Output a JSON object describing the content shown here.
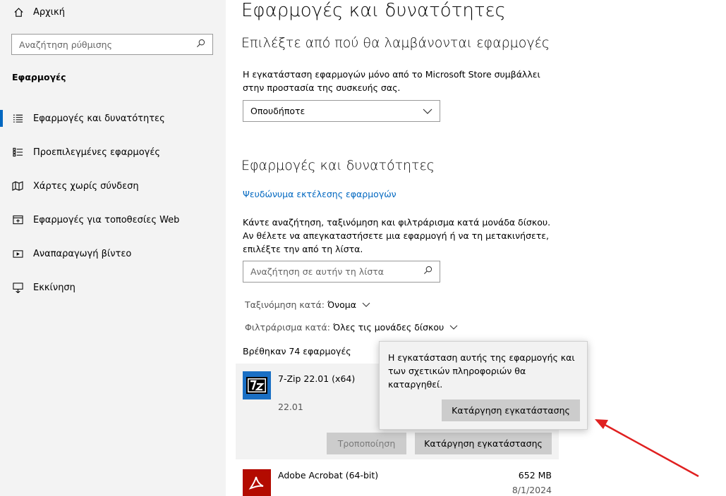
{
  "sidebar": {
    "home_label": "Αρχική",
    "search_placeholder": "Αναζήτηση ρύθμισης",
    "section_label": "Εφαρμογές",
    "items": [
      {
        "label": "Εφαρμογές και δυνατότητες",
        "icon": "apps-list-icon",
        "active": true
      },
      {
        "label": "Προεπιλεγμένες εφαρμογές",
        "icon": "default-apps-icon"
      },
      {
        "label": "Χάρτες χωρίς σύνδεση",
        "icon": "map-icon"
      },
      {
        "label": "Εφαρμογές για τοποθεσίες Web",
        "icon": "web-apps-icon"
      },
      {
        "label": "Αναπαραγωγή βίντεο",
        "icon": "video-icon"
      },
      {
        "label": "Εκκίνηση",
        "icon": "startup-icon"
      }
    ]
  },
  "main": {
    "title": "Εφαρμογές και δυνατότητες",
    "source_heading": "Επιλέξτε από πού θα λαμβάνονται εφαρμογές",
    "source_desc": "Η εγκατάσταση εφαρμογών μόνο από το Microsoft Store συμβάλλει στην προστασία της συσκευής σας.",
    "source_dropdown_value": "Οπουδήποτε",
    "apps_heading": "Εφαρμογές και δυνατότητες",
    "alias_link": "Ψευδώνυμα εκτέλεσης εφαρμογών",
    "list_desc": "Κάντε αναζήτηση, ταξινόμηση και φιλτράρισμα κατά μονάδα δίσκου. Αν θέλετε να απεγκαταστήσετε μια εφαρμογή ή να τη μετακινήσετε, επιλέξτε την από τη λίστα.",
    "list_search_placeholder": "Αναζήτηση σε αυτήν τη λίστα",
    "sort_label": "Ταξινόμηση κατά:",
    "sort_value": "Όνομα",
    "filter_label": "Φιλτράρισμα κατά:",
    "filter_value": "Όλες τις μονάδες δίσκου",
    "count_text": "Βρέθηκαν 74 εφαρμογές",
    "apps": [
      {
        "name": "7-Zip 22.01 (x64)",
        "version": "22.01",
        "size": "",
        "date": ""
      },
      {
        "name": "Adobe Acrobat (64-bit)",
        "version": "",
        "size": "652 MB",
        "date": "8/1/2024"
      }
    ],
    "modify_label": "Τροποποίηση",
    "uninstall_label": "Κατάργηση εγκατάστασης"
  },
  "popup": {
    "message": "Η εγκατάσταση αυτής της εφαρμογής και των σχετικών πληροφοριών θα καταργηθεί.",
    "confirm_label": "Κατάργηση εγκατάστασης"
  },
  "colors": {
    "accent": "#0067c0",
    "annotation_arrow": "#e02020",
    "sidebar_bg": "#f3f3f3"
  }
}
